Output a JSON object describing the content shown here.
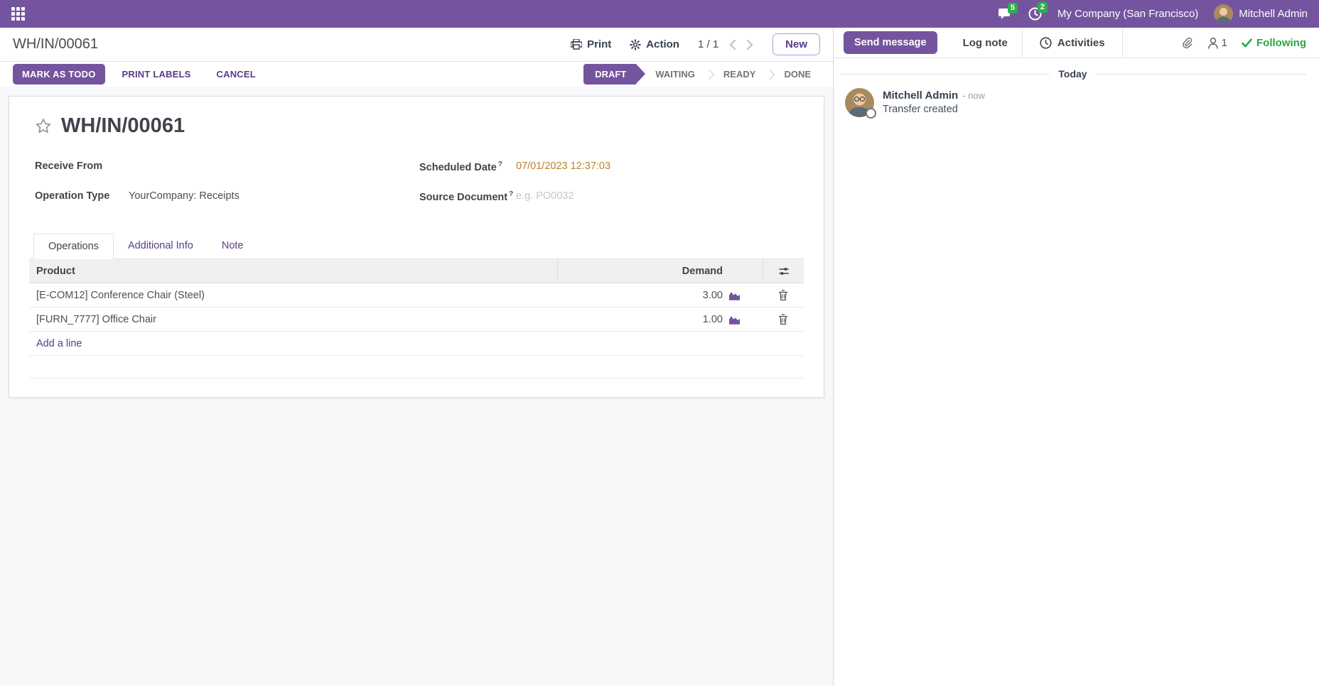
{
  "colors": {
    "primary": "#74549e",
    "warning_text": "#bd8127",
    "success": "#28a745",
    "badge_green": "#2ead4e"
  },
  "topbar": {
    "messages_badge": "5",
    "activities_badge": "2",
    "company": "My Company (San Francisco)",
    "user": "Mitchell Admin"
  },
  "control_panel": {
    "breadcrumb": "WH/IN/00061",
    "print_label": "Print",
    "action_label": "Action",
    "pager": "1 / 1",
    "new_button": "New"
  },
  "action_bar": {
    "buttons": {
      "mark_as_todo": "MARK AS TODO",
      "print_labels": "PRINT LABELS",
      "cancel": "CANCEL"
    },
    "statuses": [
      {
        "label": "DRAFT",
        "active": true
      },
      {
        "label": "WAITING",
        "active": false
      },
      {
        "label": "READY",
        "active": false
      },
      {
        "label": "DONE",
        "active": false
      }
    ]
  },
  "form": {
    "title": "WH/IN/00061",
    "help_marker": "?",
    "fields": {
      "receive_from_label": "Receive From",
      "receive_from_value": "",
      "operation_type_label": "Operation Type",
      "operation_type_value": "YourCompany: Receipts",
      "scheduled_date_label": "Scheduled Date",
      "scheduled_date_value": "07/01/2023 12:37:03",
      "source_document_label": "Source Document",
      "source_document_placeholder": "e.g. PO0032"
    },
    "tabs": [
      {
        "label": "Operations",
        "active": true
      },
      {
        "label": "Additional Info",
        "active": false
      },
      {
        "label": "Note",
        "active": false
      }
    ],
    "table": {
      "headers": {
        "product": "Product",
        "demand": "Demand"
      },
      "rows": [
        {
          "product": "[E-COM12] Conference Chair (Steel)",
          "demand": "3.00"
        },
        {
          "product": "[FURN_7777] Office Chair",
          "demand": "1.00"
        }
      ],
      "add_line": "Add a line"
    }
  },
  "chatter": {
    "send_message": "Send message",
    "log_note": "Log note",
    "activities": "Activities",
    "followers_count": "1",
    "following": "Following",
    "date_divider": "Today",
    "message": {
      "author": "Mitchell Admin",
      "time": "- now",
      "body": "Transfer created"
    }
  }
}
